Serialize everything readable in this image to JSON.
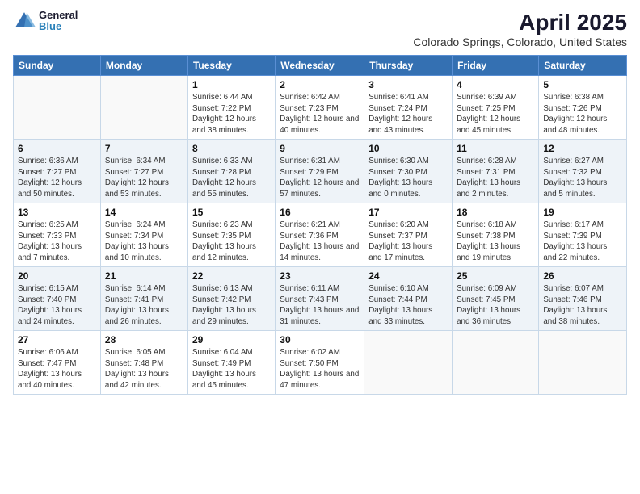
{
  "header": {
    "logo_line1": "General",
    "logo_line2": "Blue",
    "title": "April 2025",
    "subtitle": "Colorado Springs, Colorado, United States"
  },
  "weekdays": [
    "Sunday",
    "Monday",
    "Tuesday",
    "Wednesday",
    "Thursday",
    "Friday",
    "Saturday"
  ],
  "weeks": [
    [
      {
        "day": "",
        "sunrise": "",
        "sunset": "",
        "daylight": "",
        "empty": true
      },
      {
        "day": "",
        "sunrise": "",
        "sunset": "",
        "daylight": "",
        "empty": true
      },
      {
        "day": "1",
        "sunrise": "Sunrise: 6:44 AM",
        "sunset": "Sunset: 7:22 PM",
        "daylight": "Daylight: 12 hours and 38 minutes."
      },
      {
        "day": "2",
        "sunrise": "Sunrise: 6:42 AM",
        "sunset": "Sunset: 7:23 PM",
        "daylight": "Daylight: 12 hours and 40 minutes."
      },
      {
        "day": "3",
        "sunrise": "Sunrise: 6:41 AM",
        "sunset": "Sunset: 7:24 PM",
        "daylight": "Daylight: 12 hours and 43 minutes."
      },
      {
        "day": "4",
        "sunrise": "Sunrise: 6:39 AM",
        "sunset": "Sunset: 7:25 PM",
        "daylight": "Daylight: 12 hours and 45 minutes."
      },
      {
        "day": "5",
        "sunrise": "Sunrise: 6:38 AM",
        "sunset": "Sunset: 7:26 PM",
        "daylight": "Daylight: 12 hours and 48 minutes."
      }
    ],
    [
      {
        "day": "6",
        "sunrise": "Sunrise: 6:36 AM",
        "sunset": "Sunset: 7:27 PM",
        "daylight": "Daylight: 12 hours and 50 minutes."
      },
      {
        "day": "7",
        "sunrise": "Sunrise: 6:34 AM",
        "sunset": "Sunset: 7:27 PM",
        "daylight": "Daylight: 12 hours and 53 minutes."
      },
      {
        "day": "8",
        "sunrise": "Sunrise: 6:33 AM",
        "sunset": "Sunset: 7:28 PM",
        "daylight": "Daylight: 12 hours and 55 minutes."
      },
      {
        "day": "9",
        "sunrise": "Sunrise: 6:31 AM",
        "sunset": "Sunset: 7:29 PM",
        "daylight": "Daylight: 12 hours and 57 minutes."
      },
      {
        "day": "10",
        "sunrise": "Sunrise: 6:30 AM",
        "sunset": "Sunset: 7:30 PM",
        "daylight": "Daylight: 13 hours and 0 minutes."
      },
      {
        "day": "11",
        "sunrise": "Sunrise: 6:28 AM",
        "sunset": "Sunset: 7:31 PM",
        "daylight": "Daylight: 13 hours and 2 minutes."
      },
      {
        "day": "12",
        "sunrise": "Sunrise: 6:27 AM",
        "sunset": "Sunset: 7:32 PM",
        "daylight": "Daylight: 13 hours and 5 minutes."
      }
    ],
    [
      {
        "day": "13",
        "sunrise": "Sunrise: 6:25 AM",
        "sunset": "Sunset: 7:33 PM",
        "daylight": "Daylight: 13 hours and 7 minutes."
      },
      {
        "day": "14",
        "sunrise": "Sunrise: 6:24 AM",
        "sunset": "Sunset: 7:34 PM",
        "daylight": "Daylight: 13 hours and 10 minutes."
      },
      {
        "day": "15",
        "sunrise": "Sunrise: 6:23 AM",
        "sunset": "Sunset: 7:35 PM",
        "daylight": "Daylight: 13 hours and 12 minutes."
      },
      {
        "day": "16",
        "sunrise": "Sunrise: 6:21 AM",
        "sunset": "Sunset: 7:36 PM",
        "daylight": "Daylight: 13 hours and 14 minutes."
      },
      {
        "day": "17",
        "sunrise": "Sunrise: 6:20 AM",
        "sunset": "Sunset: 7:37 PM",
        "daylight": "Daylight: 13 hours and 17 minutes."
      },
      {
        "day": "18",
        "sunrise": "Sunrise: 6:18 AM",
        "sunset": "Sunset: 7:38 PM",
        "daylight": "Daylight: 13 hours and 19 minutes."
      },
      {
        "day": "19",
        "sunrise": "Sunrise: 6:17 AM",
        "sunset": "Sunset: 7:39 PM",
        "daylight": "Daylight: 13 hours and 22 minutes."
      }
    ],
    [
      {
        "day": "20",
        "sunrise": "Sunrise: 6:15 AM",
        "sunset": "Sunset: 7:40 PM",
        "daylight": "Daylight: 13 hours and 24 minutes."
      },
      {
        "day": "21",
        "sunrise": "Sunrise: 6:14 AM",
        "sunset": "Sunset: 7:41 PM",
        "daylight": "Daylight: 13 hours and 26 minutes."
      },
      {
        "day": "22",
        "sunrise": "Sunrise: 6:13 AM",
        "sunset": "Sunset: 7:42 PM",
        "daylight": "Daylight: 13 hours and 29 minutes."
      },
      {
        "day": "23",
        "sunrise": "Sunrise: 6:11 AM",
        "sunset": "Sunset: 7:43 PM",
        "daylight": "Daylight: 13 hours and 31 minutes."
      },
      {
        "day": "24",
        "sunrise": "Sunrise: 6:10 AM",
        "sunset": "Sunset: 7:44 PM",
        "daylight": "Daylight: 13 hours and 33 minutes."
      },
      {
        "day": "25",
        "sunrise": "Sunrise: 6:09 AM",
        "sunset": "Sunset: 7:45 PM",
        "daylight": "Daylight: 13 hours and 36 minutes."
      },
      {
        "day": "26",
        "sunrise": "Sunrise: 6:07 AM",
        "sunset": "Sunset: 7:46 PM",
        "daylight": "Daylight: 13 hours and 38 minutes."
      }
    ],
    [
      {
        "day": "27",
        "sunrise": "Sunrise: 6:06 AM",
        "sunset": "Sunset: 7:47 PM",
        "daylight": "Daylight: 13 hours and 40 minutes."
      },
      {
        "day": "28",
        "sunrise": "Sunrise: 6:05 AM",
        "sunset": "Sunset: 7:48 PM",
        "daylight": "Daylight: 13 hours and 42 minutes."
      },
      {
        "day": "29",
        "sunrise": "Sunrise: 6:04 AM",
        "sunset": "Sunset: 7:49 PM",
        "daylight": "Daylight: 13 hours and 45 minutes."
      },
      {
        "day": "30",
        "sunrise": "Sunrise: 6:02 AM",
        "sunset": "Sunset: 7:50 PM",
        "daylight": "Daylight: 13 hours and 47 minutes."
      },
      {
        "day": "",
        "sunrise": "",
        "sunset": "",
        "daylight": "",
        "empty": true
      },
      {
        "day": "",
        "sunrise": "",
        "sunset": "",
        "daylight": "",
        "empty": true
      },
      {
        "day": "",
        "sunrise": "",
        "sunset": "",
        "daylight": "",
        "empty": true
      }
    ]
  ]
}
